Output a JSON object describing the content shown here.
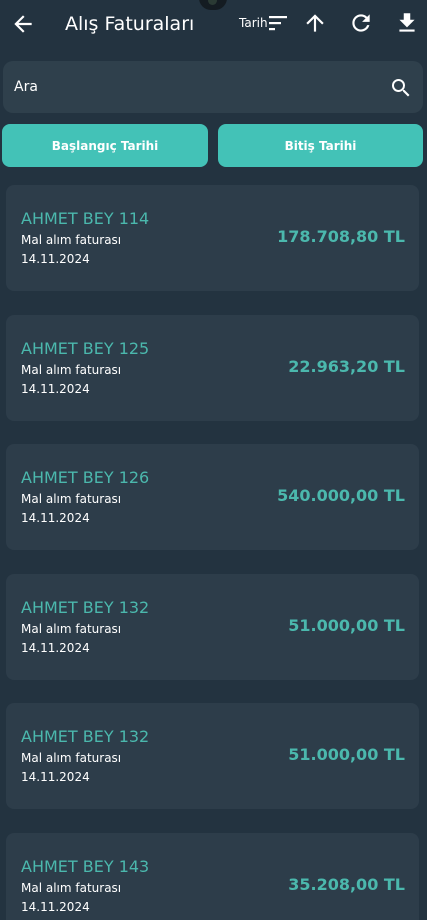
{
  "header": {
    "title": "Alış Faturaları",
    "sort_label": "Tarih"
  },
  "search": {
    "placeholder": "Ara",
    "value": ""
  },
  "filters": {
    "start_label": "Başlangıç Tarihi",
    "end_label": "Bitiş Tarihi"
  },
  "invoices": [
    {
      "name": "AHMET BEY 114",
      "desc": "Mal alım faturası",
      "date": "14.11.2024",
      "amount": "178.708,80 TL"
    },
    {
      "name": "AHMET BEY 125",
      "desc": "Mal alım faturası",
      "date": "14.11.2024",
      "amount": "22.963,20 TL"
    },
    {
      "name": "AHMET BEY 126",
      "desc": "Mal alım faturası",
      "date": "14.11.2024",
      "amount": "540.000,00 TL"
    },
    {
      "name": "AHMET BEY 132",
      "desc": "Mal alım faturası",
      "date": "14.11.2024",
      "amount": "51.000,00 TL"
    },
    {
      "name": "AHMET BEY 132",
      "desc": "Mal alım faturası",
      "date": "14.11.2024",
      "amount": "51.000,00 TL"
    },
    {
      "name": "AHMET BEY 143",
      "desc": "Mal alım faturası",
      "date": "14.11.2024",
      "amount": "35.208,00 TL"
    }
  ],
  "colors": {
    "background": "#233340",
    "card": "#2d3d4a",
    "accent": "#43c2b7",
    "accent_text": "#4bb8ad"
  },
  "icons": {
    "back": "arrow-left-icon",
    "sort": "sort-lines-icon",
    "up": "arrow-up-icon",
    "refresh": "refresh-icon",
    "download": "download-icon",
    "search": "search-icon"
  }
}
